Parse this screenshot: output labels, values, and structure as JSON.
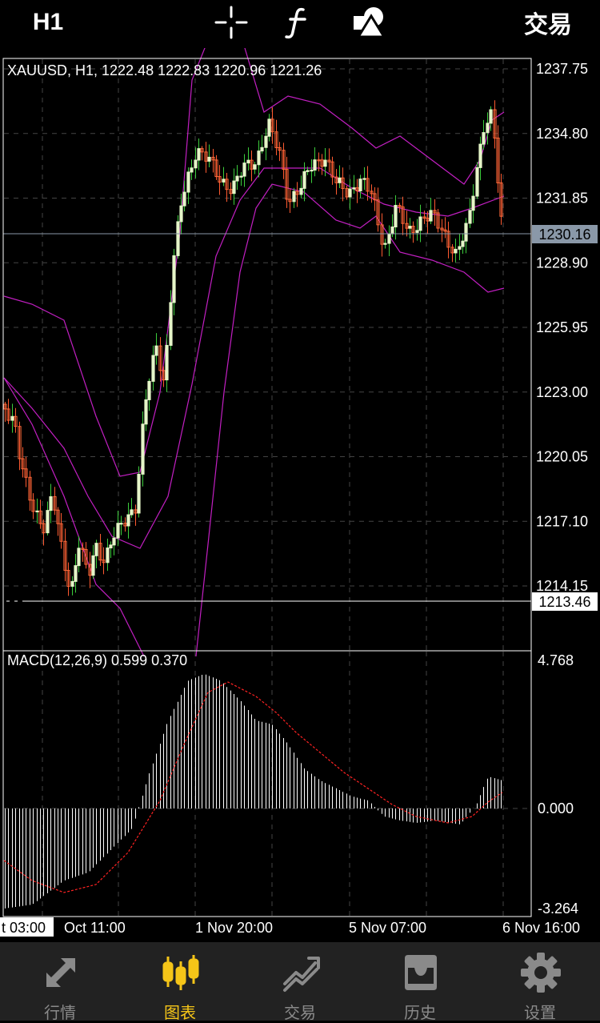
{
  "topbar": {
    "timeframe": "H1",
    "crosshair_icon": "crosshair-icon",
    "indicator_icon": "function-icon",
    "objects_icon": "shapes-icon",
    "trade_label": "交易"
  },
  "chart": {
    "symbol_info": "XAUUSD, H1, 1222.48 1222.83 1220.96 1221.26",
    "price_ticks": [
      "1237.75",
      "1234.80",
      "1231.85",
      "1228.90",
      "1225.95",
      "1223.00",
      "1220.05",
      "1217.10",
      "1214.15"
    ],
    "bid_price": "1230.16",
    "marked_price": "1213.46",
    "macd_label": "MACD(12,26,9) 0.599 0.370",
    "macd_ticks": [
      "4.768",
      "0.000",
      "-3.264"
    ],
    "time_labels": [
      "t 03:00",
      "Oct 11:00",
      "1 Nov 20:00",
      "5 Nov 07:00",
      "6 Nov 16:00"
    ],
    "colors": {
      "bull": "#e5f5c8",
      "bear": "#ff6a3a",
      "up_wick": "#3ccd3c",
      "down_wick": "#ff5a30",
      "bands": "#c21fc2",
      "signal": "#ff2222",
      "histogram": "#ffffff",
      "bid_bg": "#8a98a8"
    }
  },
  "tabs": [
    {
      "label": "行情",
      "icon": "quotes-icon",
      "active": false
    },
    {
      "label": "图表",
      "icon": "chart-icon",
      "active": true
    },
    {
      "label": "交易",
      "icon": "trade-icon",
      "active": false
    },
    {
      "label": "历史",
      "icon": "history-icon",
      "active": false
    },
    {
      "label": "设置",
      "icon": "settings-gear-icon",
      "active": false
    }
  ]
}
